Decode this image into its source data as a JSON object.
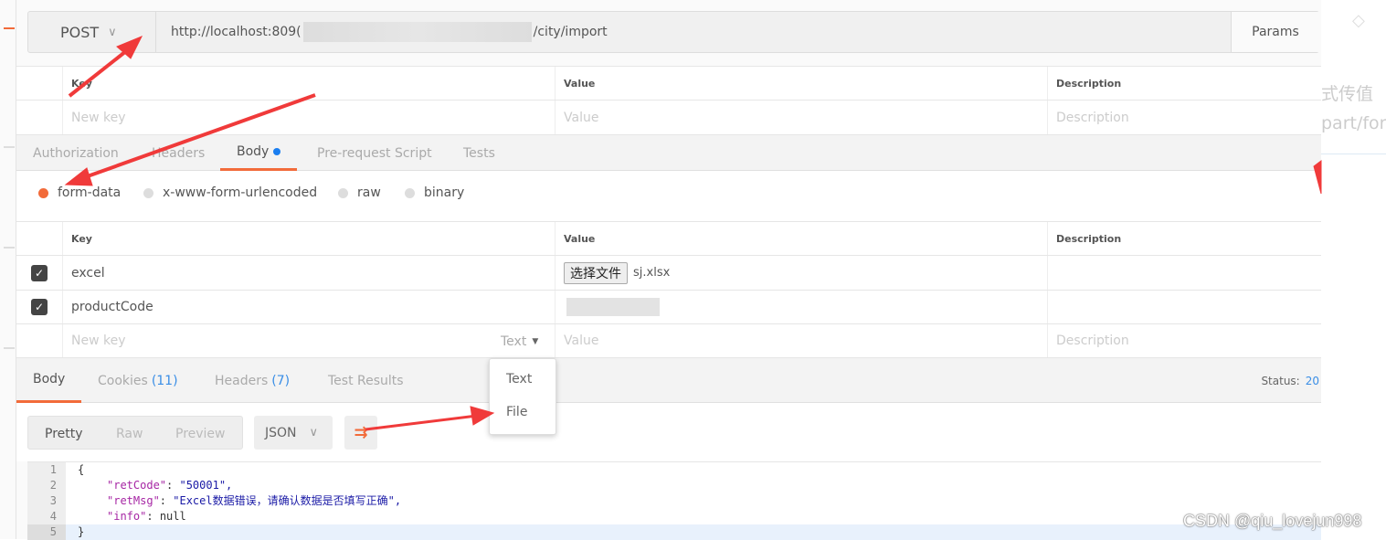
{
  "request": {
    "method": "POST",
    "url_prefix": "http://localhost:809(",
    "url_suffix": "/city/import",
    "params_label": "Params"
  },
  "params_table": {
    "headers": [
      "Key",
      "Value",
      "Description"
    ],
    "placeholders": [
      "New key",
      "Value",
      "Description"
    ]
  },
  "request_tabs": [
    {
      "label": "Authorization"
    },
    {
      "label": "Headers"
    },
    {
      "label": "Body",
      "active": true,
      "has_dot": true
    },
    {
      "label": "Pre-request Script"
    },
    {
      "label": "Tests"
    }
  ],
  "body_modes": [
    {
      "label": "form-data",
      "selected": true
    },
    {
      "label": "x-www-form-urlencoded"
    },
    {
      "label": "raw"
    },
    {
      "label": "binary"
    }
  ],
  "form_table": {
    "headers": [
      "Key",
      "Value",
      "Description"
    ],
    "rows": [
      {
        "checked": true,
        "key": "excel",
        "file_button": "选择文件",
        "file_name": "sj.xlsx"
      },
      {
        "checked": true,
        "key": "productCode"
      }
    ],
    "new_row": {
      "key_placeholder": "New key",
      "type": "Text",
      "value_placeholder": "Value",
      "description_placeholder": "Description"
    }
  },
  "type_dropdown": {
    "options": [
      "Text",
      "File"
    ]
  },
  "response": {
    "tabs": [
      {
        "label": "Body",
        "active": true
      },
      {
        "label": "Cookies",
        "count": "(11)"
      },
      {
        "label": "Headers",
        "count": "(7)"
      },
      {
        "label": "Test Results"
      }
    ],
    "status_label": "Status:",
    "status_value": "20",
    "formats": [
      "Pretty",
      "Raw",
      "Preview"
    ],
    "language": "JSON",
    "code_lines": [
      {
        "n": "1",
        "text": "{"
      },
      {
        "n": "2",
        "key": "\"retCode\"",
        "value": "\"50001\","
      },
      {
        "n": "3",
        "key": "\"retMsg\"",
        "value": "\"Excel数据错误，请确认数据是否填写正确\","
      },
      {
        "n": "4",
        "key": "\"info\"",
        "value": "null"
      },
      {
        "n": "5",
        "text": "}"
      }
    ]
  },
  "background_text": [
    "式传值",
    "part/forr"
  ],
  "watermark": "CSDN @qiu_lovejun998",
  "colors": {
    "accent": "#f26b3a",
    "link": "#3a8ee6",
    "arrow": "#f03a3a"
  }
}
